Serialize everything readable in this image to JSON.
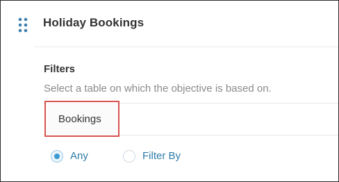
{
  "panel": {
    "title": "Holiday Bookings",
    "drag_icon": "drag-handle-icon"
  },
  "filters": {
    "heading": "Filters",
    "help_text": "Select a table on which the objective is based on.",
    "selected_table": "Bookings",
    "highlight_color": "#d9534f",
    "radio_options": [
      {
        "label": "Any",
        "checked": true
      },
      {
        "label": "Filter By",
        "checked": false
      }
    ]
  },
  "colors": {
    "accent": "#3d9ad1",
    "link_text": "#2d7ba8",
    "title_text": "#333333",
    "muted_text": "#8a8a8a"
  }
}
